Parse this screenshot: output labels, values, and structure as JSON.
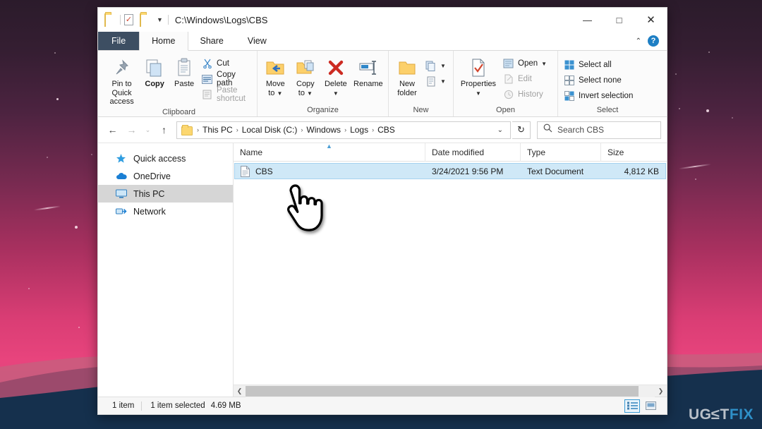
{
  "window": {
    "title_path": "C:\\Windows\\Logs\\CBS",
    "quick_access": [
      {
        "name": "folder-icon",
        "label": "Folder"
      },
      {
        "name": "properties-icon",
        "label": "Properties"
      },
      {
        "name": "new-folder-icon",
        "label": "New folder"
      },
      {
        "name": "customize-qat-icon",
        "label": "Customize Quick Access Toolbar"
      }
    ],
    "controls": {
      "minimize": "—",
      "maximize": "□",
      "close": "✕"
    }
  },
  "tabs": [
    {
      "label": "File",
      "active": false,
      "kind": "file"
    },
    {
      "label": "Home",
      "active": true,
      "kind": "normal"
    },
    {
      "label": "Share",
      "active": false,
      "kind": "normal"
    },
    {
      "label": "View",
      "active": false,
      "kind": "normal"
    }
  ],
  "tab_right": {
    "collapse_icon": "⌃",
    "help_label": "?"
  },
  "ribbon": {
    "groups": [
      {
        "label": "Clipboard",
        "big": [
          {
            "label": "Pin to Quick\naccess",
            "icon": "pin-icon",
            "disabled": false
          },
          {
            "label": "Copy",
            "icon": "copy-icon",
            "disabled": false
          },
          {
            "label": "Paste",
            "icon": "paste-icon",
            "disabled": false
          }
        ],
        "small": [
          {
            "label": "Cut",
            "icon": "cut-icon",
            "disabled": false
          },
          {
            "label": "Copy path",
            "icon": "copy-path-icon",
            "disabled": false
          },
          {
            "label": "Paste shortcut",
            "icon": "paste-shortcut-icon",
            "disabled": true
          }
        ]
      },
      {
        "label": "Organize",
        "big": [
          {
            "label": "Move\nto",
            "icon": "move-to-icon",
            "caret": true
          },
          {
            "label": "Copy\nto",
            "icon": "copy-to-icon",
            "caret": true
          },
          {
            "label": "Delete",
            "icon": "delete-icon",
            "caret": true
          },
          {
            "label": "Rename",
            "icon": "rename-icon",
            "caret": false
          }
        ],
        "small": []
      },
      {
        "label": "New",
        "big": [
          {
            "label": "New\nfolder",
            "icon": "new-folder-icon",
            "caret": false
          }
        ],
        "small": [
          {
            "label": "",
            "icon": "new-item-icon",
            "caret": true
          },
          {
            "label": "",
            "icon": "easy-access-icon",
            "caret": true
          }
        ]
      },
      {
        "label": "Open",
        "big": [
          {
            "label": "Properties",
            "icon": "properties-icon",
            "caret": true
          }
        ],
        "small": [
          {
            "label": "Open",
            "icon": "open-icon",
            "disabled": false,
            "caret": true
          },
          {
            "label": "Edit",
            "icon": "edit-icon",
            "disabled": true
          },
          {
            "label": "History",
            "icon": "history-icon",
            "disabled": true
          }
        ]
      },
      {
        "label": "Select",
        "big": [],
        "small": [
          {
            "label": "Select all",
            "icon": "select-all-icon",
            "disabled": false
          },
          {
            "label": "Select none",
            "icon": "select-none-icon",
            "disabled": false
          },
          {
            "label": "Invert selection",
            "icon": "invert-selection-icon",
            "disabled": false
          }
        ]
      }
    ]
  },
  "addressbar": {
    "back_icon": "←",
    "forward_icon": "→",
    "recent_icon": "⌄",
    "up_icon": "↑",
    "breadcrumbs": [
      "This PC",
      "Local Disk (C:)",
      "Windows",
      "Logs",
      "CBS"
    ],
    "separator": "›",
    "dropdown_icon": "⌄",
    "refresh_icon": "↻",
    "search_placeholder": "Search CBS",
    "search_value": ""
  },
  "navpane": {
    "items": [
      {
        "label": "Quick access",
        "icon": "star-pin-icon",
        "selected": false
      },
      {
        "label": "OneDrive",
        "icon": "onedrive-cloud-icon",
        "selected": false
      },
      {
        "label": "This PC",
        "icon": "this-pc-monitor-icon",
        "selected": true
      },
      {
        "label": "Network",
        "icon": "network-icon",
        "selected": false
      }
    ]
  },
  "filelist": {
    "columns": [
      "Name",
      "Date modified",
      "Type",
      "Size"
    ],
    "sorted_column": "Name",
    "sort_direction": "asc",
    "rows": [
      {
        "name": "CBS",
        "date_modified": "3/24/2021 9:56 PM",
        "type": "Text Document",
        "size": "4,812 KB",
        "icon": "text-document-icon",
        "selected": true
      }
    ]
  },
  "statusbar": {
    "item_count": "1 item",
    "selection": "1 item selected",
    "selection_size": "4.69 MB",
    "views": [
      {
        "name": "details-view",
        "active": true
      },
      {
        "name": "large-icons-view",
        "active": false
      }
    ]
  },
  "watermark": {
    "part1": "UG",
    "part2": "≤",
    "part3": "T",
    "part4": "FIX"
  },
  "cursor": {
    "type": "pointing-hand"
  }
}
